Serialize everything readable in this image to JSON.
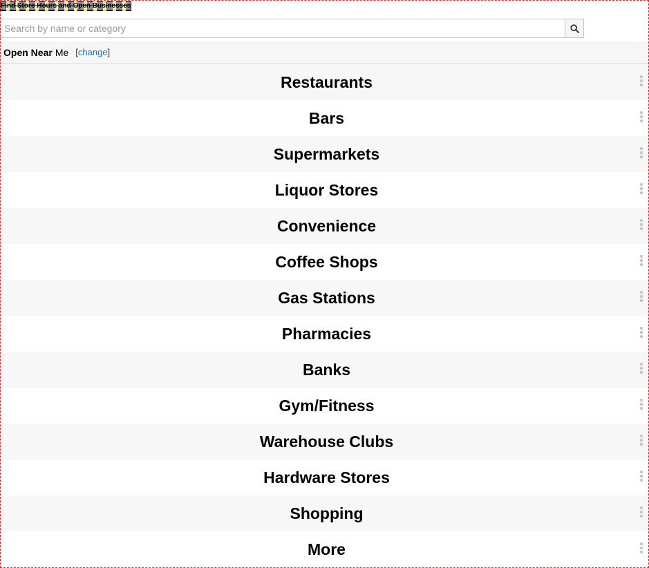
{
  "page": {
    "title": "Find Store Hours and Open Businesses"
  },
  "search": {
    "placeholder": "Search by name or category",
    "value": "",
    "button_icon": "search-icon"
  },
  "location": {
    "open_label": "Open Near",
    "place_label": "Me",
    "change_open_bracket": "[",
    "change_label": "change",
    "change_close_bracket": "]"
  },
  "categories": [
    {
      "label": "Restaurants",
      "icon": "more-vertical-icon"
    },
    {
      "label": "Bars",
      "icon": "more-vertical-icon"
    },
    {
      "label": "Supermarkets",
      "icon": "more-vertical-icon"
    },
    {
      "label": "Liquor Stores",
      "icon": "more-vertical-icon"
    },
    {
      "label": "Convenience",
      "icon": "more-vertical-icon"
    },
    {
      "label": "Coffee Shops",
      "icon": "more-vertical-icon"
    },
    {
      "label": "Gas Stations",
      "icon": "more-vertical-icon"
    },
    {
      "label": "Pharmacies",
      "icon": "more-vertical-icon"
    },
    {
      "label": "Banks",
      "icon": "more-vertical-icon"
    },
    {
      "label": "Gym/Fitness",
      "icon": "more-vertical-icon"
    },
    {
      "label": "Warehouse Clubs",
      "icon": "more-vertical-icon"
    },
    {
      "label": "Hardware Stores",
      "icon": "more-vertical-icon"
    },
    {
      "label": "Shopping",
      "icon": "more-vertical-icon"
    },
    {
      "label": "More",
      "icon": "more-vertical-icon"
    }
  ],
  "colors": {
    "link": "#1a73c8",
    "row_alt": "#f7f7f7",
    "frame_border": "#d9302f"
  }
}
